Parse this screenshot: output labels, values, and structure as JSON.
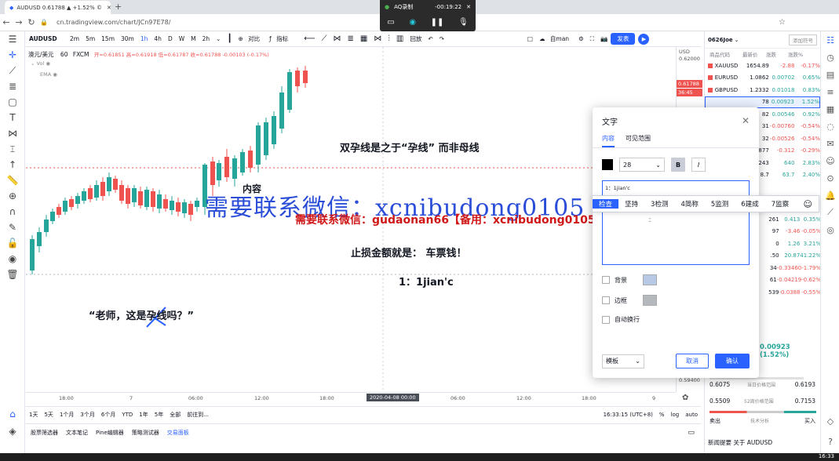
{
  "browser": {
    "tab_title": "AUDUSD 0.61788 ▲ +1.52% ©",
    "url": "cn.tradingview.com/chart/JCn97E78/"
  },
  "recorder": {
    "title": "AQ录制",
    "time": "-00:19:22"
  },
  "toolbar": {
    "symbol": "AUDUSD",
    "intervals": [
      "2m",
      "5m",
      "15m",
      "30m",
      "1h",
      "4h",
      "D",
      "W",
      "M",
      "2h"
    ],
    "compare": "对比",
    "indicators": "指标",
    "publish_label": "发表",
    "alert": "预警",
    "camera": "回放",
    "user": "自man"
  },
  "legend": {
    "title": "澳元/美元",
    "interval": "60",
    "exchange": "FXCM",
    "ohlc": "开=0.61851 高=0.61918 低=0.61787 收=0.61788 -0.00103 (-0.17%)",
    "vol": "Vol",
    "ema": "EMA"
  },
  "chart_annotations": {
    "text1": "双孕线是之于“孕线” 而非母线",
    "text_inner": "内容",
    "text2": "止损金额就是： 车票钱！",
    "text3": "1：1jian'c",
    "quote": "“老师，这是孕线吗？”",
    "watermark_blue": "需要联系微信：xcnibudong0105",
    "watermark_red": "需要联系微信：gudaonan66【备用：xcnibudong0105】"
  },
  "price_axis": {
    "top_label": "USD",
    "top_price": "0.62000",
    "price_tag": "0.61788",
    "time_tag": "36:45",
    "bottom_price": "0.59400"
  },
  "time_axis": {
    "labels": [
      "18:00",
      "7",
      "06:00",
      "12:00",
      "18:00",
      "06:00",
      "12:00",
      "18:00",
      "9"
    ],
    "highlight": "2020-04-08   00:00"
  },
  "range_bar": {
    "ranges": [
      "1天",
      "5天",
      "1个月",
      "3个月",
      "6个月",
      "YTD",
      "1年",
      "5年",
      "全部"
    ],
    "goto": "前往到...",
    "clock": "16:33:15 (UTC+8)",
    "pct": "%",
    "log": "log",
    "auto": "auto"
  },
  "bottom_tabs": [
    "股票筛选器",
    "文本笔记",
    "Pine编辑器",
    "策略测试器",
    "交易面板"
  ],
  "watchlist": {
    "name": "0626Joe",
    "add_label": "添加符号",
    "columns": [
      "商品代码",
      "最新价",
      "涨跌",
      "涨跌%"
    ],
    "rows": [
      {
        "sym": "XAUUSD",
        "last": "1654.89",
        "chg": "-2.88",
        "pct": "-0.17%",
        "dir": "down"
      },
      {
        "sym": "EURUSD",
        "last": "1.0862",
        "chg": "0.00702",
        "pct": "0.65%",
        "dir": "up"
      },
      {
        "sym": "GBPUSD",
        "last": "1.2332",
        "chg": "0.01018",
        "pct": "0.83%",
        "dir": "up"
      },
      {
        "sym": "",
        "last": "78",
        "chg": "0.00923",
        "pct": "1.52%",
        "dir": "up"
      },
      {
        "sym": "",
        "last": "82",
        "chg": "0.00546",
        "pct": "0.92%",
        "dir": "up"
      },
      {
        "sym": "",
        "last": "31",
        "chg": "-0.00760",
        "pct": "-0.54%",
        "dir": "down"
      },
      {
        "sym": "",
        "last": "32",
        "chg": "-0.00526",
        "pct": "-0.54%",
        "dir": "down"
      },
      {
        "sym": "",
        "last": "877",
        "chg": "-0.312",
        "pct": "-0.29%",
        "dir": "down"
      },
      {
        "sym": "",
        "last": "243",
        "chg": "640",
        "pct": "2.83%",
        "dir": "up"
      },
      {
        "sym": "",
        "last": "8.7",
        "chg": "63.7",
        "pct": "2.40%",
        "dir": "up"
      }
    ],
    "rows2": [
      {
        "last": "261",
        "chg": "0.413",
        "pct": "0.35%",
        "dir": "up"
      },
      {
        "last": "97",
        "chg": "-3.46",
        "pct": "-0.05%",
        "dir": "down"
      },
      {
        "last": "0",
        "chg": "1.26",
        "pct": "3.21%",
        "dir": "up"
      },
      {
        "last": ".50",
        "chg": "20.87",
        "pct": "41.22%",
        "dir": "up"
      },
      {
        "last": "34",
        "chg": "-0.33460",
        "pct": "-1.79%",
        "dir": "down"
      },
      {
        "last": "61",
        "chg": "-0.04219",
        "pct": "-0.62%",
        "dir": "down"
      },
      {
        "last": "539",
        "chg": "-0.0388",
        "pct": "-0.55%",
        "dir": "down"
      }
    ],
    "detail_change": "0.00923 (1.52%)",
    "low": "0.6075",
    "high": "0.6193",
    "range_label": "当日价格范围",
    "low52": "0.5509",
    "high52": "0.7153",
    "range52_label": "52周价格范围",
    "sell": "卖出",
    "analysis": "技术分析",
    "buy": "买入",
    "news": "新闻提要 关于 AUDUSD"
  },
  "dialog": {
    "title": "文字",
    "tab_content": "内容",
    "tab_visibility": "可见范围",
    "font_size": "28",
    "bold": "B",
    "italic": "I",
    "text_value": "1：1jian'c",
    "background_label": "背景",
    "border_label": "边框",
    "wrap_label": "自动换行",
    "template_label": "模板",
    "cancel": "取消",
    "ok": "确认"
  },
  "suggest": [
    "检查",
    "坚持",
    "3检测",
    "4简称",
    "5监测",
    "6建成",
    "7监察"
  ],
  "taskbar_time": "16:33",
  "colors": {
    "up": "#26a69a",
    "down": "#ef5350",
    "accent": "#2962ff",
    "candle_up": "#26a69a",
    "candle_down": "#ef5350"
  }
}
